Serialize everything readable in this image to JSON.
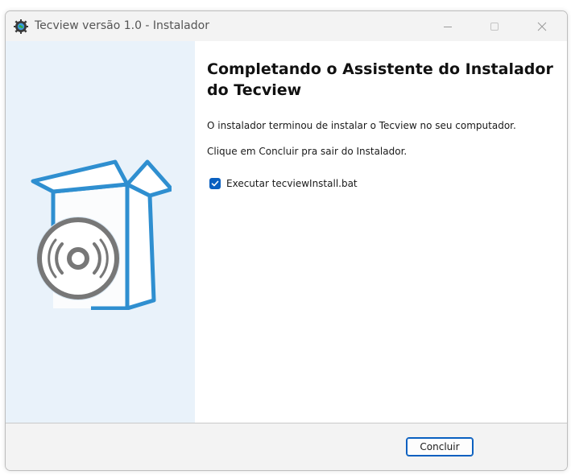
{
  "window": {
    "title": "Tecview versão 1.0 - Instalador"
  },
  "titlebar": {
    "app_icon": "gear-globe-icon",
    "minimize_icon": "minimize-icon",
    "maximize_icon": "maximize-icon",
    "close_icon": "close-icon"
  },
  "side_panel": {
    "graphic": "box-with-disc-icon",
    "colors": {
      "background": "#e9f2fa",
      "box_stroke": "#2f8fd0",
      "disc": "#7a7a7a"
    }
  },
  "main": {
    "heading": "Completando o Assistente do Instalador do Tecview",
    "message_1": "O instalador terminou de instalar o Tecview no seu computador.",
    "message_2": "Clique em Concluir pra sair do Instalador.",
    "run_option": {
      "label": "Executar tecviewInstall.bat",
      "checked": true
    }
  },
  "footer": {
    "conclude_label": "Concluir"
  },
  "colors": {
    "accent": "#0a60c0"
  }
}
